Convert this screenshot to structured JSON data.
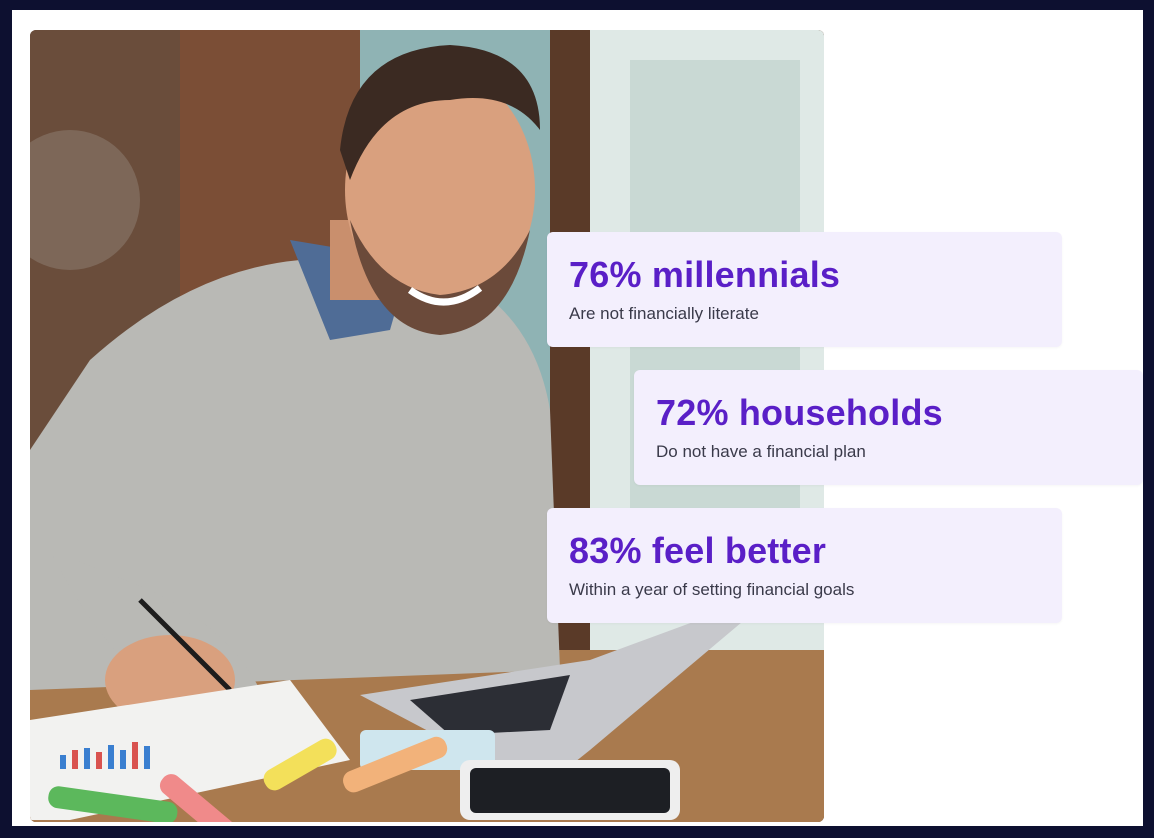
{
  "stats": [
    {
      "headline": "76% millennials",
      "caption": "Are not financially literate"
    },
    {
      "headline": "72% households",
      "caption": "Do not have a financial plan"
    },
    {
      "headline": "83% feel better",
      "caption": "Within a year of setting financial goals"
    }
  ],
  "colors": {
    "accent": "#5a1fc7",
    "card_background": "#f3effd",
    "page_border": "#0d1030"
  }
}
